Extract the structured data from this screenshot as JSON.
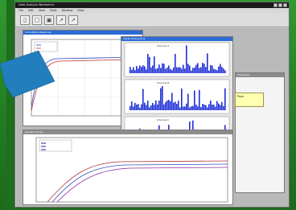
{
  "window": {
    "title": "Data Analysis Workbench",
    "menus": [
      "File",
      "Edit",
      "View",
      "Tools",
      "Window",
      "Help"
    ]
  },
  "toolbar": {
    "icons": [
      "new-icon",
      "open-icon",
      "save-icon",
      "plot-icon",
      "zoom-icon"
    ]
  },
  "panels": {
    "main_plot_title": "Cumulative Response",
    "histograms_title": "Signal Histograms",
    "bottom_plot_title": "Growth Curves",
    "right_panel_title": "Properties",
    "histogram_labels": [
      "Channel A",
      "Channel B",
      "Channel C"
    ]
  },
  "tooltip": {
    "text": "Peak"
  },
  "colors": {
    "accent": "#2a6bd6",
    "bars": "#1f2fd6",
    "arrow": "#1f79b8"
  }
}
